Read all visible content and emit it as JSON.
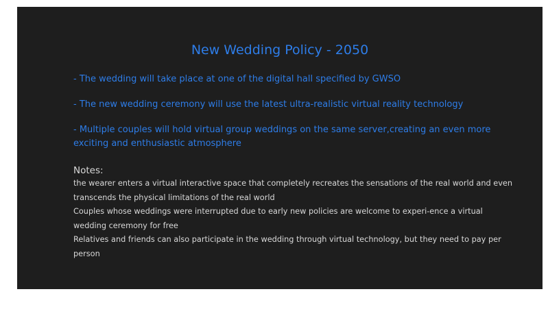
{
  "slide": {
    "title": "New Wedding Policy - 2050",
    "bullets": [
      "-  The wedding will take place at one of the digital hall specified by GWSO",
      "-  The new wedding ceremony will use the latest ultra-realistic virtual reality technology",
      "-  Multiple couples will hold virtual group weddings on the same server,creating an even more exciting and enthusiastic atmosphere"
    ],
    "notes_heading": "Notes:",
    "notes": [
      "the wearer enters a virtual interactive space that completely recreates the sensations of the real world and even transcends the physical limitations of the real world",
      "Couples whose weddings were interrupted due to early new policies are welcome to experi-ence a virtual wedding ceremony for free",
      "Relatives and friends can also participate in the wedding through virtual technology, but they need to pay per person"
    ],
    "colors": {
      "background": "#1e1e1e",
      "accent_blue": "#2e7de8",
      "notes_text": "#d9d9d9"
    }
  }
}
